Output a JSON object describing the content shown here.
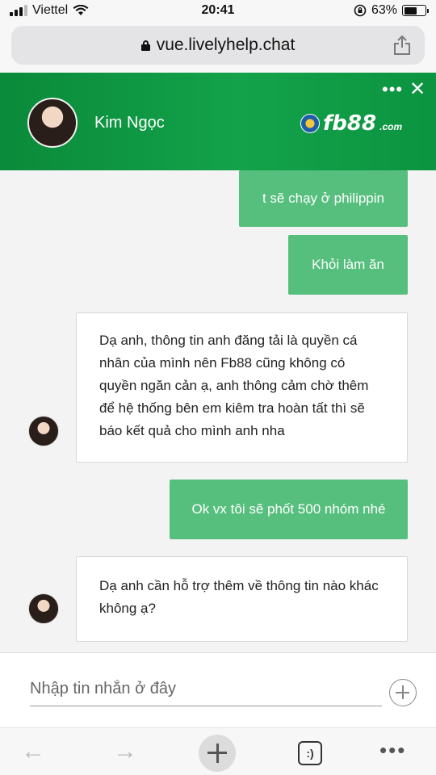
{
  "status_bar": {
    "carrier": "Viettel",
    "time": "20:41",
    "battery_percent": "63%",
    "battery_level": 0.63
  },
  "browser": {
    "url": "vue.livelyhelp.chat",
    "toolbar_icons": [
      "back-arrow-icon",
      "forward-arrow-icon",
      "new-tab-icon",
      "tabs-icon",
      "more-icon"
    ]
  },
  "chat_header": {
    "agent_name": "Kim Ngọc",
    "brand_text": "fb88",
    "brand_suffix": ".com",
    "menu_glyph": "•••",
    "close_glyph": "✕"
  },
  "messages": [
    {
      "direction": "out",
      "text": "t sẽ chạy ở philippin"
    },
    {
      "direction": "out",
      "text": "Khỏi làm ăn"
    },
    {
      "direction": "in",
      "text": "Dạ anh, thông tin anh đăng tải là quyền cá nhân của mình nên Fb88 cũng không có quyền ngăn cản ạ, anh thông cảm chờ thêm để hệ thống bên em kiêm tra hoàn tất thì sẽ báo kết quả cho mình anh nha"
    },
    {
      "direction": "out",
      "text": "Ok vx tôi sẽ phốt 500 nhóm nhé"
    },
    {
      "direction": "in",
      "text": "Dạ anh cần hỗ trợ thêm về thông tin nào khác không ạ?"
    }
  ],
  "composer": {
    "placeholder": "Nhập tin nhắn ở đây",
    "value": ""
  },
  "colors": {
    "header_green": "#13a24a",
    "outgoing_bubble": "#56bf7d",
    "incoming_bubble": "#ffffff"
  }
}
